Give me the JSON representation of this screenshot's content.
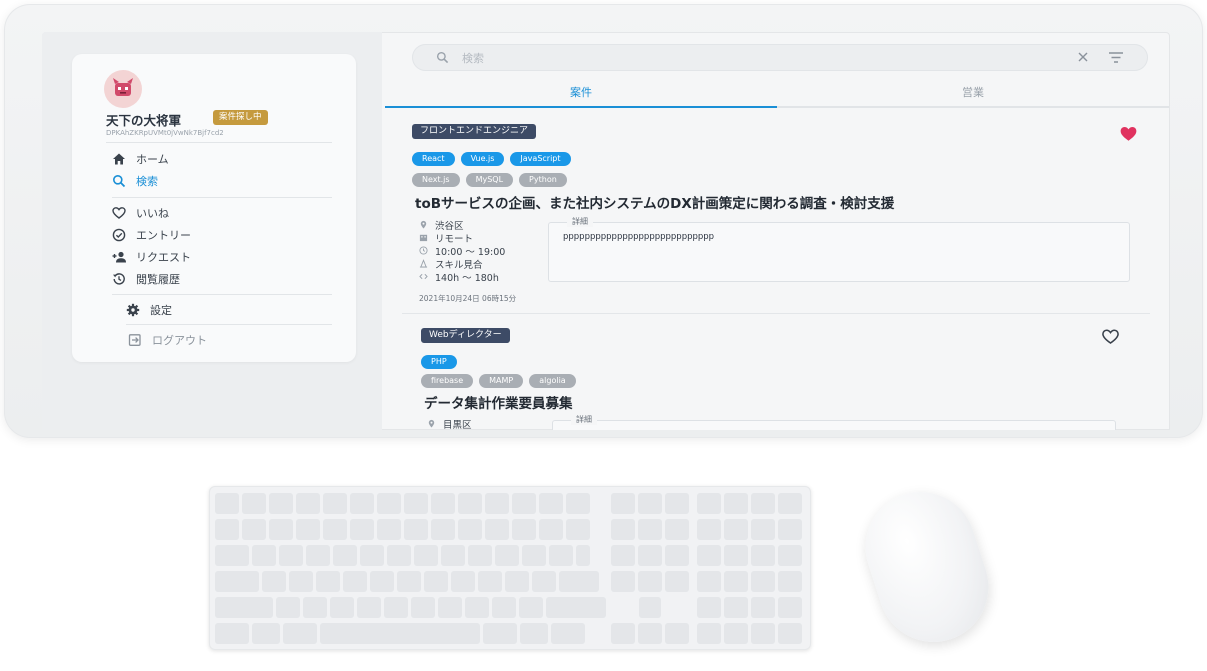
{
  "user": {
    "name": "天下の大将軍",
    "status": "案件探し中",
    "id": "DPKAhZKRpUVMt0jVwNk7Bjf7cd2"
  },
  "nav": {
    "home": "ホーム",
    "search": "検索",
    "likes": "いいね",
    "entries": "エントリー",
    "requests": "リクエスト",
    "history": "閲覧履歴",
    "settings": "設定",
    "logout": "ログアウト"
  },
  "search": {
    "placeholder": "検索"
  },
  "tabs": [
    "案件",
    "営業"
  ],
  "jobs": [
    {
      "category": "フロントエンドエンジニア",
      "skills": [
        "React",
        "Vue.js",
        "JavaScript"
      ],
      "sub_skills": [
        "Next.js",
        "MySQL",
        "Python"
      ],
      "title": "toBサービスの企画、また社内システムのDX計画策定に関わる調査・検討支援",
      "location": "渋谷区",
      "work_style": "リモート",
      "hours": "10:00 〜 19:00",
      "salary": "スキル見合",
      "work_hours_month": "140h 〜 180h",
      "detail_label": "詳細",
      "detail": "pppppppppppppppppppppppppppp",
      "posted": "2021年10月24日 06時15分",
      "favorited": true
    },
    {
      "category": "Webディレクター",
      "skills": [
        "PHP"
      ],
      "sub_skills": [
        "firebase",
        "MAMP",
        "algolia"
      ],
      "title": "データ集計作業要員募集",
      "location": "目黒区",
      "detail_label": "詳細",
      "favorited": false
    }
  ],
  "colors": {
    "accent": "#1a8fd6",
    "category_badge": "#3d4b66",
    "skill_chip": "#1a98e8",
    "sub_skill_chip": "#a9aeb4",
    "status_badge": "#c59a3e",
    "heart": "#e0325f"
  }
}
